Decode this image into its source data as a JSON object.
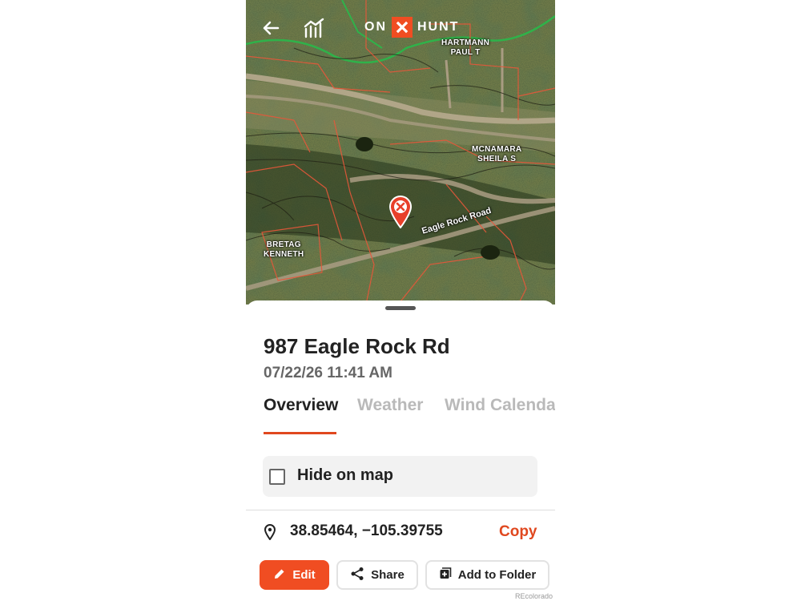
{
  "header": {
    "back_icon": "arrow-left-icon",
    "chart_icon": "chart-icon",
    "logo": {
      "left": "ON",
      "right": "HUNT",
      "mark": "X"
    }
  },
  "map": {
    "owners": [
      {
        "line1": "HARTMANN",
        "line2": "PAUL T"
      },
      {
        "line1": "MCNAMARA",
        "line2": "SHEILA S"
      },
      {
        "line1": "BRETAG",
        "line2": "KENNETH"
      }
    ],
    "road_label": "Eagle Rock Road",
    "pin_icon": "waypoint-pin-icon"
  },
  "sheet": {
    "title": "987 Eagle Rock Rd",
    "datetime": "07/22/26 11:41 AM",
    "tabs": [
      {
        "label": "Overview",
        "active": true
      },
      {
        "label": "Weather",
        "active": false
      },
      {
        "label": "Wind Calendar",
        "active": false
      }
    ],
    "hide_on_map": {
      "label": "Hide on map",
      "checked": false
    },
    "coordinates": "38.85464, −105.39755",
    "copy_label": "Copy",
    "actions": {
      "edit": "Edit",
      "share": "Share",
      "add_to_folder": "Add to Folder"
    },
    "credit": "REcolorado"
  },
  "colors": {
    "accent": "#f04d22",
    "parcel_line": "#e8573a",
    "public_land": "#2fb24a",
    "text_dark": "#222222",
    "text_muted": "#666666"
  }
}
